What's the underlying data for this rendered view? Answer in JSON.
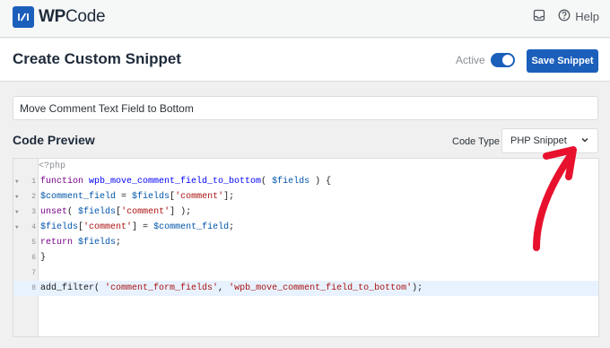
{
  "brand": {
    "logo_wp": "WP",
    "logo_code": "Code"
  },
  "topbar": {
    "help_label": "Help"
  },
  "header": {
    "title": "Create Custom Snippet",
    "active_label": "Active",
    "active": true,
    "save_label": "Save Snippet"
  },
  "snippet": {
    "title_value": "Move Comment Text Field to Bottom",
    "code_preview_label": "Code Preview",
    "code_type_label": "Code Type",
    "code_type_value": "PHP Snippet"
  },
  "code": {
    "placeholder": "<?php",
    "lines": [
      {
        "number": "1",
        "foldable": true,
        "active": false,
        "tokens": [
          {
            "t": "kw",
            "v": "function "
          },
          {
            "t": "fn",
            "v": "wpb_move_comment_field_to_bottom"
          },
          {
            "t": "",
            "v": "( "
          },
          {
            "t": "var",
            "v": "$fields"
          },
          {
            "t": "",
            "v": " ) {"
          }
        ]
      },
      {
        "number": "2",
        "foldable": true,
        "active": false,
        "tokens": [
          {
            "t": "var",
            "v": "$comment_field"
          },
          {
            "t": "",
            "v": " = "
          },
          {
            "t": "var",
            "v": "$fields"
          },
          {
            "t": "",
            "v": "["
          },
          {
            "t": "str",
            "v": "'comment'"
          },
          {
            "t": "",
            "v": "];"
          }
        ]
      },
      {
        "number": "3",
        "foldable": true,
        "active": false,
        "tokens": [
          {
            "t": "kw",
            "v": "unset"
          },
          {
            "t": "",
            "v": "( "
          },
          {
            "t": "var",
            "v": "$fields"
          },
          {
            "t": "",
            "v": "["
          },
          {
            "t": "str",
            "v": "'comment'"
          },
          {
            "t": "",
            "v": "] );"
          }
        ]
      },
      {
        "number": "4",
        "foldable": true,
        "active": false,
        "tokens": [
          {
            "t": "var",
            "v": "$fields"
          },
          {
            "t": "",
            "v": "["
          },
          {
            "t": "str",
            "v": "'comment'"
          },
          {
            "t": "",
            "v": "] = "
          },
          {
            "t": "var",
            "v": "$comment_field"
          },
          {
            "t": "",
            "v": ";"
          }
        ]
      },
      {
        "number": "5",
        "foldable": false,
        "active": false,
        "tokens": [
          {
            "t": "kw",
            "v": "return "
          },
          {
            "t": "var",
            "v": "$fields"
          },
          {
            "t": "",
            "v": ";"
          }
        ]
      },
      {
        "number": "6",
        "foldable": false,
        "active": false,
        "tokens": [
          {
            "t": "",
            "v": "}"
          }
        ]
      },
      {
        "number": "7",
        "foldable": false,
        "active": false,
        "tokens": []
      },
      {
        "number": "8",
        "foldable": false,
        "active": true,
        "tokens": [
          {
            "t": "",
            "v": "add_filter( "
          },
          {
            "t": "str",
            "v": "'comment_form_fields'"
          },
          {
            "t": "",
            "v": ", "
          },
          {
            "t": "str",
            "v": "'wpb_move_comment_field_to_bottom'"
          },
          {
            "t": "",
            "v": ");"
          }
        ]
      }
    ]
  },
  "colors": {
    "accent": "#1b5fbb",
    "arrow": "#e8112d"
  },
  "icons": {
    "logo": "wpcode-logo-icon",
    "inbox": "inbox-icon",
    "help": "help-circle-icon",
    "chevron": "chevron-down-icon",
    "arrow": "red-arrow-annotation"
  }
}
